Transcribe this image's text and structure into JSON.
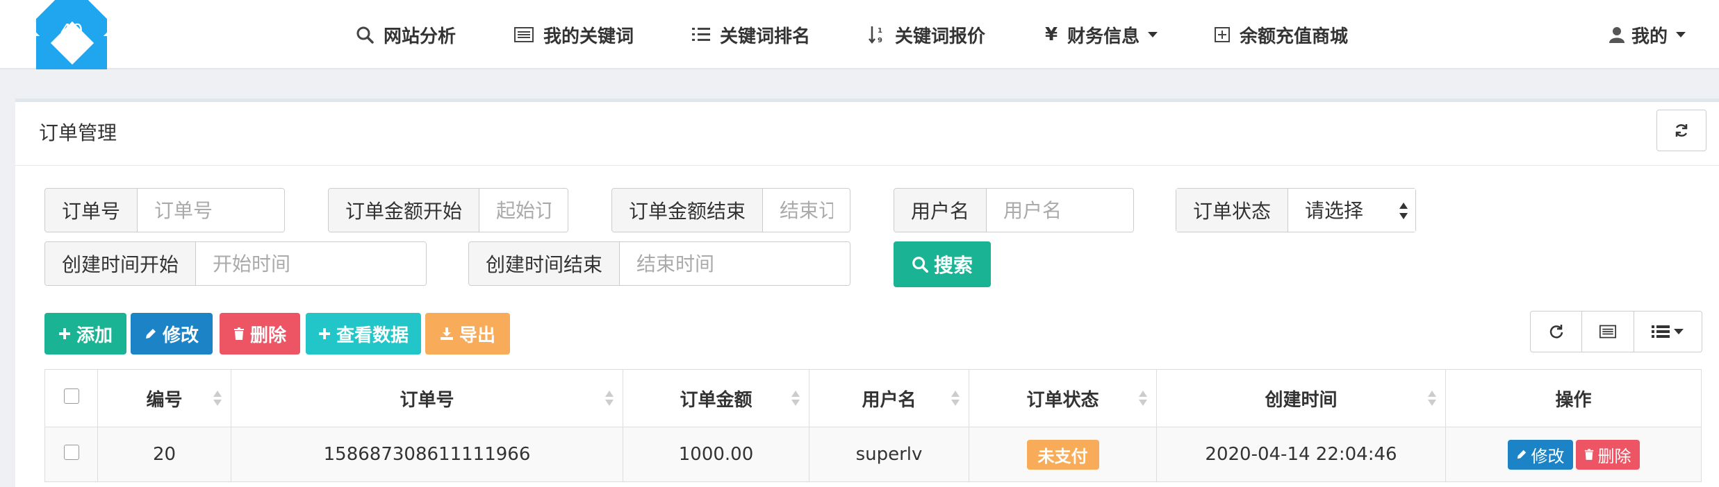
{
  "logo": {
    "number": "40"
  },
  "nav": {
    "items": [
      {
        "label": "网站分析",
        "icon": "search-icon"
      },
      {
        "label": "我的关键词",
        "icon": "list-alt-icon"
      },
      {
        "label": "关键词排名",
        "icon": "ordered-list-icon"
      },
      {
        "label": "关键词报价",
        "icon": "sort-numeric-icon"
      },
      {
        "label": "财务信息",
        "icon": "yen-icon",
        "dropdown": true
      },
      {
        "label": "余额充值商城",
        "icon": "plus-square-icon"
      }
    ],
    "user": {
      "label": "我的",
      "icon": "user-icon",
      "dropdown": true
    }
  },
  "panel": {
    "title": "订单管理",
    "refresh_icon": "refresh-icon"
  },
  "search": {
    "order_no": {
      "label": "订单号",
      "placeholder": "订单号"
    },
    "amount_start": {
      "label": "订单金额开始",
      "placeholder": "起始订"
    },
    "amount_end": {
      "label": "订单金额结束",
      "placeholder": "结束订"
    },
    "username": {
      "label": "用户名",
      "placeholder": "用户名"
    },
    "status": {
      "label": "订单状态",
      "selected": "请选择"
    },
    "created_start": {
      "label": "创建时间开始",
      "placeholder": "开始时间"
    },
    "created_end": {
      "label": "创建时间结束",
      "placeholder": "结束时间"
    },
    "search_button": "搜索"
  },
  "toolbar": {
    "add": "添加",
    "edit": "修改",
    "delete": "删除",
    "view_data": "查看数据",
    "export": "导出"
  },
  "colors": {
    "green": "#1ab394",
    "blue": "#1c84c6",
    "red": "#ed5565",
    "cyan": "#23c6c8",
    "orange": "#f8ac59",
    "logo_blue": "#1fa6ee"
  },
  "table": {
    "columns": [
      "编号",
      "订单号",
      "订单金额",
      "用户名",
      "订单状态",
      "创建时间",
      "操作"
    ],
    "rows": [
      {
        "id": "20",
        "order_no": "158687308611111966",
        "amount": "1000.00",
        "username": "superlv",
        "status": "未支付",
        "created_at": "2020-04-14 22:04:46",
        "actions": {
          "edit": "修改",
          "delete": "删除"
        }
      }
    ]
  }
}
